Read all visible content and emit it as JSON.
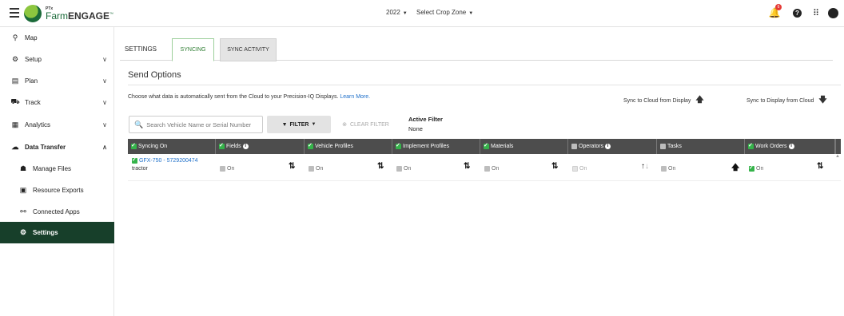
{
  "header": {
    "brand_sup": "PTx",
    "brand_prefix": "Farm",
    "brand_main": "ENGAGE",
    "brand_tm": "™",
    "year": "2022",
    "crop_zone": "Select Crop Zone",
    "notification_count": "6",
    "icons": [
      "menu-icon",
      "bell-icon",
      "help-icon",
      "apps-grid-icon",
      "account-icon"
    ]
  },
  "sidebar": {
    "items": [
      {
        "label": "Map",
        "icon": "map-icon"
      },
      {
        "label": "Setup",
        "icon": "gear-icon"
      },
      {
        "label": "Plan",
        "icon": "clipboard-icon"
      },
      {
        "label": "Track",
        "icon": "tractor-icon"
      },
      {
        "label": "Analytics",
        "icon": "analytics-icon"
      },
      {
        "label": "Data Transfer",
        "icon": "cloud-icon"
      },
      {
        "label": "Manage Files",
        "icon": "folder-icon"
      },
      {
        "label": "Resource Exports",
        "icon": "export-icon"
      },
      {
        "label": "Connected Apps",
        "icon": "connect-icon"
      },
      {
        "label": "Settings",
        "icon": "settings-icon"
      }
    ]
  },
  "page": {
    "settings_label": "SETTINGS",
    "tabs": [
      "SYNCING",
      "SYNC ACTIVITY"
    ],
    "section_title": "Send Options",
    "description": "Choose what data is automatically sent from the Cloud to your Precision-IQ Displays.",
    "learn_more": "Learn More.",
    "sync_to_cloud": "Sync to Cloud from Display",
    "sync_to_display": "Sync to Display from Cloud"
  },
  "filters": {
    "search_placeholder": "Search Vehicle Name or Serial Number",
    "filter_label": "FILTER",
    "clear_label": "CLEAR FILTER",
    "active_filter_label": "Active Filter",
    "active_filter_value": "None"
  },
  "table": {
    "columns": [
      "Syncing On",
      "Fields",
      "Vehicle Profiles",
      "Implement Profiles",
      "Materials",
      "Operators",
      "Tasks",
      "Work Orders"
    ],
    "row": {
      "device": "GFX-750 - 5729200474",
      "type": "tractor",
      "values": [
        "On",
        "On",
        "On",
        "On",
        "On",
        "On",
        "On"
      ]
    }
  },
  "colors": {
    "accent_green": "#35b34a",
    "sidebar_active": "#173f2a",
    "table_header": "#4d4d4d",
    "link_blue": "#1e6fc9"
  }
}
